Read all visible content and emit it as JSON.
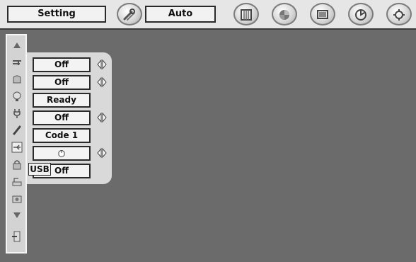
{
  "topbar": {
    "setting_label": "Setting",
    "mode_label": "Auto",
    "icons": [
      "tools-icon",
      "film-icon",
      "color-wheel-icon",
      "screen-icon",
      "brightness-dial-icon",
      "settings-gear-icon"
    ]
  },
  "sidebar": {
    "icons": [
      "scroll-up-arrow-icon",
      "projector-lens-icon",
      "filter-icon",
      "lamp-icon",
      "power-plug-icon",
      "remote-control-icon",
      "usb-icon",
      "lock-icon",
      "reset-icon",
      "camera-icon",
      "scroll-down-arrow-icon",
      "exit-icon"
    ]
  },
  "menu": {
    "rows": [
      {
        "value": "Off",
        "has_arrows": true
      },
      {
        "value": "Off",
        "has_arrows": true
      },
      {
        "value": "Ready",
        "has_arrows": false
      },
      {
        "value": "Off",
        "has_arrows": true
      },
      {
        "value": "Code 1",
        "has_arrows": false
      },
      {
        "value": "",
        "icon": "mouse-icon",
        "has_arrows": true
      },
      {
        "value": "Off",
        "has_arrows": false
      }
    ]
  },
  "tooltip": {
    "text": "USB"
  },
  "colors": {
    "background": "#6b6b6b",
    "panel": "#d9d9d9",
    "topbar": "#e6e6e6"
  }
}
